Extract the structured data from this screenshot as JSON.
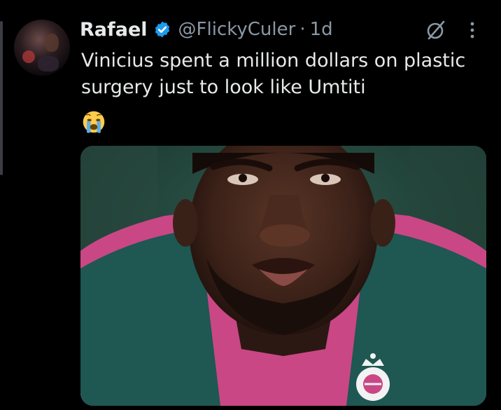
{
  "tweet": {
    "display_name": "Rafael",
    "handle": "@FlickyCuler",
    "separator": "·",
    "time": "1d",
    "text": "Vinicius spent a million dollars on plastic surgery just to look like Umtiti",
    "emoji": "😭",
    "icons": {
      "verified": "verified-badge-icon",
      "grok": "grok-icon",
      "more": "more-options-icon"
    }
  },
  "colors": {
    "background": "#000000",
    "text": "#e7e9ea",
    "muted": "#8b98a5",
    "verified_blue": "#1d9bf0"
  }
}
